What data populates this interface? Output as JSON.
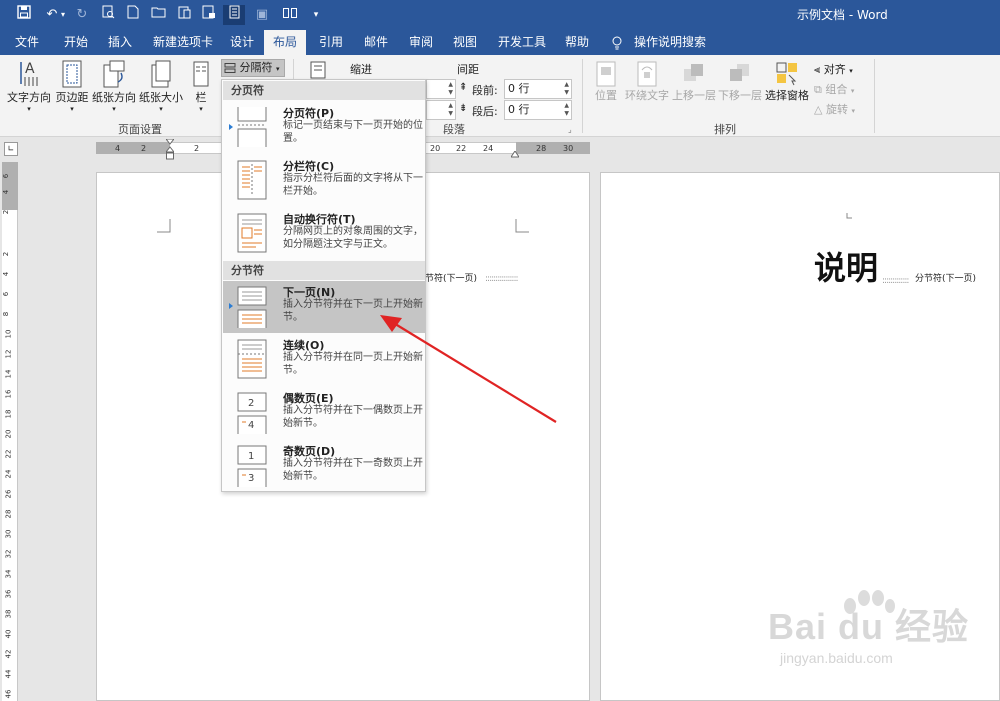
{
  "window": {
    "title": "示例文档 - Word"
  },
  "tabs": [
    {
      "label": "文件"
    },
    {
      "label": "开始"
    },
    {
      "label": "插入"
    },
    {
      "label": "新建选项卡"
    },
    {
      "label": "设计"
    },
    {
      "label": "布局"
    },
    {
      "label": "引用"
    },
    {
      "label": "邮件"
    },
    {
      "label": "审阅"
    },
    {
      "label": "视图"
    },
    {
      "label": "开发工具"
    },
    {
      "label": "帮助"
    }
  ],
  "tell_me": "操作说明搜索",
  "ribbon": {
    "page_setup": {
      "text_direction": "文字方向",
      "margins": "页边距",
      "orientation": "纸张方向",
      "size": "纸张大小",
      "columns": "栏",
      "breaks": "分隔符",
      "group_label": "页面设置"
    },
    "paragraph": {
      "indent_label": "缩进",
      "spacing_label": "间距",
      "before_label": "段前:",
      "before_value": "0 行",
      "after_label": "段后:",
      "after_value": "0 行",
      "group_label": "段落"
    },
    "arrange": {
      "position": "位置",
      "wrap_text": "环绕文字",
      "bring_forward": "上移一层",
      "send_backward": "下移一层",
      "selection_pane": "选择窗格",
      "align": "对齐",
      "group": "组合",
      "rotate": "旋转",
      "group_label": "排列"
    }
  },
  "ruler": {
    "ticks": [
      "4",
      "2",
      "2",
      "20",
      "22",
      "24",
      "28",
      "30"
    ],
    "vticks": [
      "6",
      "4",
      "2",
      "2",
      "4",
      "6",
      "8",
      "10",
      "12",
      "14",
      "16",
      "18",
      "20",
      "22",
      "24",
      "26",
      "28",
      "30",
      "32",
      "34",
      "36",
      "38",
      "40",
      "42",
      "44",
      "46"
    ]
  },
  "breaks_menu": {
    "page_breaks_header": "分页符",
    "section_breaks_header": "分节符",
    "items": [
      {
        "title": "分页符(P)",
        "desc": "标记一页结束与下一页开始的位置。"
      },
      {
        "title": "分栏符(C)",
        "desc": "指示分栏符后面的文字将从下一栏开始。"
      },
      {
        "title": "自动换行符(T)",
        "desc": "分隔网页上的对象周围的文字，如分隔题注文字与正文。"
      },
      {
        "title": "下一页(N)",
        "desc": "插入分节符并在下一页上开始新节。"
      },
      {
        "title": "连续(O)",
        "desc": "插入分节符并在同一页上开始新节。"
      },
      {
        "title": "偶数页(E)",
        "desc": "插入分节符并在下一偶数页上开始新节。"
      },
      {
        "title": "奇数页(D)",
        "desc": "插入分节符并在下一奇数页上开始新节。"
      }
    ]
  },
  "document": {
    "page1_break_text": "节符(下一页)",
    "heading": "说明",
    "page2_break_text": "分节符(下一页)"
  },
  "watermark": {
    "main": "Bai du 经验",
    "sub": "jingyan.baidu.com"
  },
  "colors": {
    "brand": "#2b579a",
    "annotation_arrow": "#e02424"
  }
}
